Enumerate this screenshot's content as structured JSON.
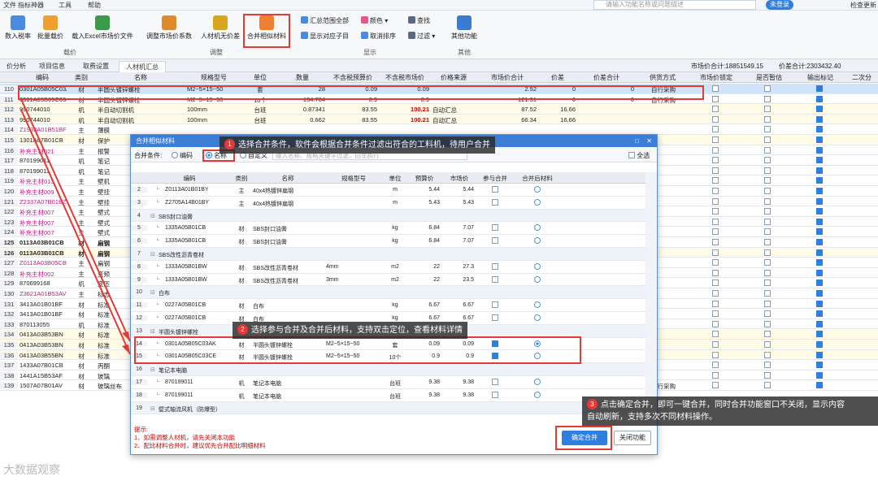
{
  "menu": [
    "文件",
    "指标神器",
    "工具",
    "帮助"
  ],
  "search_placeholder": "请输入功能名称或问题描述",
  "login": "未登录",
  "check_update": "检查更新",
  "ribbon": {
    "btn_tax": "数入税率",
    "btn_batch": "批量载价",
    "btn_excel": "载入Excel市场价文件",
    "group1": "载价",
    "btn_adjust": "调整市场价系数",
    "btn_nomaterial": "人材机无价差",
    "btn_merge": "合并相似材料",
    "group2": "调整",
    "btn_summary": "汇总范围全部",
    "btn_showsub": "显示对应子目",
    "btn_color": "颜色",
    "btn_cancelsort": "取消排序",
    "btn_find": "查找",
    "btn_filter": "过滤",
    "group3": "显示",
    "btn_other": "其他功能",
    "group4": "其他"
  },
  "tabs": [
    "价分析",
    "项目信息",
    "取费设置",
    "人材机汇总"
  ],
  "totals": {
    "market": "市场价合计:18851549.15",
    "diff": "价差合计:2303432.40"
  },
  "grid_headers": [
    "编码",
    "类别",
    "名称",
    "规格型号",
    "单位",
    "数量",
    "不含税预算价",
    "不含税市场价",
    "价格来源",
    "市场价合计",
    "价差",
    "价差合计",
    "供货方式",
    "市场价锁定",
    "是否暂估",
    "输出标记",
    "二次分"
  ],
  "grid_rows": [
    {
      "n": "110",
      "code": "0301A05B05C03AK",
      "cat": "材",
      "name": "半圆头镀锌螺栓",
      "spec": "M2~5×15~50",
      "unit": "套",
      "qty": "28",
      "pb": "0.09",
      "pm": "0.09",
      "src": "",
      "tm": "2.52",
      "d": "0",
      "td": "0",
      "sup": "自行采购",
      "lock": false,
      "est": false,
      "out": true,
      "cls": "rowsel"
    },
    {
      "n": "111",
      "code": "0301A05B05C03CE",
      "cat": "材",
      "name": "半圆头镀锌螺栓",
      "spec": "M2~5×15~50",
      "unit": "10个",
      "qty": "134.784",
      "pb": "0.9",
      "pm": "0.9",
      "src": "",
      "tm": "121.31",
      "d": "0",
      "td": "0",
      "sup": "自行采购",
      "lock": false,
      "est": false,
      "out": true,
      "cls": ""
    },
    {
      "n": "112",
      "code": "990744010",
      "cat": "机",
      "name": "半自动切割机",
      "spec": "100mm",
      "unit": "台班",
      "qty": "0.87341",
      "pb": "83.55",
      "pm": "100.21",
      "src": "自动汇总",
      "tm": "87.52",
      "d": "16.66",
      "td": "",
      "sup": "",
      "lock": false,
      "est": false,
      "out": true,
      "cls": "rowy"
    },
    {
      "n": "113",
      "code": "990744010",
      "cat": "机",
      "name": "半自动切割机",
      "spec": "100mm",
      "unit": "台班",
      "qty": "0.662",
      "pb": "83.55",
      "pm": "100.21",
      "src": "自动汇总",
      "tm": "66.34",
      "d": "16.66",
      "td": "",
      "sup": "",
      "lock": false,
      "est": false,
      "out": true,
      "cls": "rowy"
    },
    {
      "n": "114",
      "code": "Z1933A01B51BF",
      "cat": "主",
      "name": "薄膜",
      "spec": "",
      "unit": "",
      "qty": "",
      "pb": "",
      "pm": "",
      "src": "",
      "tm": "",
      "d": "",
      "td": "",
      "sup": "",
      "lock": false,
      "est": false,
      "out": true,
      "cls": ""
    },
    {
      "n": "115",
      "code": "1301A07B01CB",
      "cat": "材",
      "name": "保护",
      "spec": "",
      "unit": "",
      "qty": "",
      "pb": "",
      "pm": "",
      "src": "",
      "tm": "",
      "d": "",
      "td": "",
      "sup": "",
      "lock": false,
      "est": false,
      "out": true,
      "cls": "rowy"
    },
    {
      "n": "116",
      "code": "补充主材021",
      "cat": "主",
      "name": "报警",
      "spec": "",
      "unit": "",
      "qty": "",
      "pb": "",
      "pm": "",
      "src": "",
      "tm": "",
      "d": "",
      "td": "",
      "sup": "",
      "lock": false,
      "est": false,
      "out": true,
      "cls": ""
    },
    {
      "n": "117",
      "code": "870199011",
      "cat": "机",
      "name": "笔记",
      "spec": "",
      "unit": "",
      "qty": "",
      "pb": "",
      "pm": "",
      "src": "",
      "tm": "",
      "d": "",
      "td": "",
      "sup": "",
      "lock": false,
      "est": false,
      "out": true,
      "cls": ""
    },
    {
      "n": "118",
      "code": "870199011",
      "cat": "机",
      "name": "笔记",
      "spec": "",
      "unit": "",
      "qty": "",
      "pb": "",
      "pm": "",
      "src": "",
      "tm": "",
      "d": "",
      "td": "",
      "sup": "",
      "lock": false,
      "est": false,
      "out": true,
      "cls": ""
    },
    {
      "n": "119",
      "code": "补充主材013",
      "cat": "主",
      "name": "壁机",
      "spec": "",
      "unit": "",
      "qty": "",
      "pb": "",
      "pm": "",
      "src": "",
      "tm": "",
      "d": "",
      "td": "",
      "sup": "",
      "lock": false,
      "est": false,
      "out": true,
      "cls": ""
    },
    {
      "n": "120",
      "code": "补充主材009",
      "cat": "主",
      "name": "壁挂",
      "spec": "",
      "unit": "",
      "qty": "",
      "pb": "",
      "pm": "",
      "src": "",
      "tm": "",
      "d": "",
      "td": "",
      "sup": "",
      "lock": false,
      "est": false,
      "out": true,
      "cls": ""
    },
    {
      "n": "121",
      "code": "Z2337A07B01BZ",
      "cat": "主",
      "name": "壁挂",
      "spec": "",
      "unit": "",
      "qty": "",
      "pb": "",
      "pm": "",
      "src": "",
      "tm": "",
      "d": "",
      "td": "",
      "sup": "",
      "lock": false,
      "est": false,
      "out": true,
      "cls": ""
    },
    {
      "n": "122",
      "code": "补充主材007",
      "cat": "主",
      "name": "壁式",
      "spec": "",
      "unit": "",
      "qty": "",
      "pb": "",
      "pm": "",
      "src": "",
      "tm": "",
      "d": "",
      "td": "",
      "sup": "",
      "lock": false,
      "est": false,
      "out": true,
      "cls": ""
    },
    {
      "n": "123",
      "code": "补充主材007",
      "cat": "主",
      "name": "壁式",
      "spec": "",
      "unit": "",
      "qty": "",
      "pb": "",
      "pm": "",
      "src": "",
      "tm": "",
      "d": "",
      "td": "",
      "sup": "",
      "lock": false,
      "est": false,
      "out": true,
      "cls": ""
    },
    {
      "n": "124",
      "code": "补充主材007",
      "cat": "主",
      "name": "壁式",
      "spec": "",
      "unit": "",
      "qty": "",
      "pb": "",
      "pm": "",
      "src": "",
      "tm": "",
      "d": "",
      "td": "",
      "sup": "",
      "lock": false,
      "est": false,
      "out": true,
      "cls": ""
    },
    {
      "n": "125",
      "code": "0113A03B01CB",
      "cat": "材",
      "name": "扁钢",
      "spec": "",
      "unit": "",
      "qty": "",
      "pb": "",
      "pm": "",
      "src": "",
      "tm": "",
      "d": "",
      "td": "",
      "sup": "",
      "lock": false,
      "est": false,
      "out": true,
      "cls": "bold"
    },
    {
      "n": "126",
      "code": "0113A03B01CB",
      "cat": "材",
      "name": "扁钢",
      "spec": "",
      "unit": "",
      "qty": "",
      "pb": "",
      "pm": "",
      "src": "",
      "tm": "",
      "d": "",
      "td": "",
      "sup": "",
      "lock": false,
      "est": false,
      "out": true,
      "cls": "bold rowy"
    },
    {
      "n": "127",
      "code": "Z0113A03B05CB",
      "cat": "主",
      "name": "扁钢",
      "spec": "",
      "unit": "",
      "qty": "",
      "pb": "",
      "pm": "",
      "src": "",
      "tm": "",
      "d": "",
      "td": "",
      "sup": "",
      "lock": false,
      "est": false,
      "out": true,
      "cls": ""
    },
    {
      "n": "128",
      "code": "补充主材002",
      "cat": "主",
      "name": "变频",
      "spec": "",
      "unit": "",
      "qty": "",
      "pb": "",
      "pm": "",
      "src": "",
      "tm": "",
      "d": "",
      "td": "",
      "sup": "",
      "lock": false,
      "est": false,
      "out": true,
      "cls": ""
    },
    {
      "n": "129",
      "code": "870699168",
      "cat": "机",
      "name": "变压",
      "spec": "",
      "unit": "",
      "qty": "",
      "pb": "",
      "pm": "",
      "src": "",
      "tm": "",
      "d": "",
      "td": "",
      "sup": "",
      "lock": false,
      "est": false,
      "out": true,
      "cls": ""
    },
    {
      "n": "130",
      "code": "Z3621A01B53AV",
      "cat": "主",
      "name": "标志",
      "spec": "",
      "unit": "",
      "qty": "",
      "pb": "",
      "pm": "",
      "src": "",
      "tm": "",
      "d": "",
      "td": "",
      "sup": "",
      "lock": false,
      "est": false,
      "out": true,
      "cls": ""
    },
    {
      "n": "131",
      "code": "3413A01B01BF",
      "cat": "材",
      "name": "标准",
      "spec": "",
      "unit": "",
      "qty": "",
      "pb": "",
      "pm": "",
      "src": "",
      "tm": "",
      "d": "",
      "td": "",
      "sup": "",
      "lock": false,
      "est": false,
      "out": true,
      "cls": ""
    },
    {
      "n": "132",
      "code": "3413A01B01BF",
      "cat": "材",
      "name": "标准",
      "spec": "",
      "unit": "",
      "qty": "",
      "pb": "",
      "pm": "",
      "src": "",
      "tm": "",
      "d": "",
      "td": "",
      "sup": "",
      "lock": false,
      "est": false,
      "out": true,
      "cls": ""
    },
    {
      "n": "133",
      "code": "870113055",
      "cat": "机",
      "name": "标准",
      "spec": "",
      "unit": "",
      "qty": "",
      "pb": "",
      "pm": "",
      "src": "",
      "tm": "",
      "d": "",
      "td": "",
      "sup": "",
      "lock": false,
      "est": false,
      "out": true,
      "cls": ""
    },
    {
      "n": "134",
      "code": "0413A03B53BN",
      "cat": "材",
      "name": "标准",
      "spec": "",
      "unit": "",
      "qty": "",
      "pb": "",
      "pm": "",
      "src": "",
      "tm": "",
      "d": "",
      "td": "",
      "sup": "",
      "lock": false,
      "est": false,
      "out": true,
      "cls": "rowy"
    },
    {
      "n": "135",
      "code": "0413A03B53BN",
      "cat": "材",
      "name": "标准",
      "spec": "",
      "unit": "",
      "qty": "",
      "pb": "",
      "pm": "",
      "src": "",
      "tm": "",
      "d": "",
      "td": "",
      "sup": "",
      "lock": false,
      "est": false,
      "out": true,
      "cls": "rowy"
    },
    {
      "n": "136",
      "code": "0413A03B55BN",
      "cat": "材",
      "name": "标准",
      "spec": "",
      "unit": "",
      "qty": "",
      "pb": "",
      "pm": "",
      "src": "",
      "tm": "",
      "d": "",
      "td": "",
      "sup": "",
      "lock": false,
      "est": false,
      "out": true,
      "cls": "rowy"
    },
    {
      "n": "137",
      "code": "1433A07B01CB",
      "cat": "材",
      "name": "丙酮",
      "spec": "",
      "unit": "",
      "qty": "",
      "pb": "",
      "pm": "",
      "src": "",
      "tm": "",
      "d": "",
      "td": "",
      "sup": "",
      "lock": false,
      "est": false,
      "out": true,
      "cls": ""
    },
    {
      "n": "138",
      "code": "1441A15B53AF",
      "cat": "材",
      "name": "玻璃",
      "spec": "",
      "unit": "",
      "qty": "",
      "pb": "",
      "pm": "",
      "src": "",
      "tm": "",
      "d": "",
      "td": "",
      "sup": "",
      "lock": false,
      "est": false,
      "out": true,
      "cls": ""
    },
    {
      "n": "139",
      "code": "1507A07B01AV",
      "cat": "材",
      "name": "玻璃丝布",
      "spec": "",
      "unit": "m2",
      "qty": "245.448",
      "pb": "2.48",
      "pm": "2.48",
      "src": "",
      "tm": "608.71",
      "d": "0",
      "td": "0",
      "sup": "自行采购",
      "lock": false,
      "est": false,
      "out": true,
      "cls": ""
    }
  ],
  "dialog": {
    "title": "合并相似材料",
    "cond_label": "合并条件:",
    "opt_code": "编码",
    "opt_name": "名称",
    "opt_custom": "自定义",
    "custom_placeholder": "输入名称、规格关键字过滤，回车执行",
    "all_label": "全选",
    "headers": [
      "编码",
      "类别",
      "名称",
      "规格型号",
      "单位",
      "预算价",
      "市场价",
      "参与合并",
      "合并后材料"
    ],
    "rows": [
      {
        "n": "2",
        "code": "Z0113A01B01BY",
        "cat": "主",
        "name": "40x4热镀锌扁钢",
        "spec": "",
        "unit": "m",
        "pb": "5.44",
        "pm": "5.44",
        "join": false,
        "after": false,
        "g": false
      },
      {
        "n": "3",
        "code": "Z2705A14B01BY",
        "cat": "主",
        "name": "40x4热镀锌扁钢",
        "spec": "",
        "unit": "m",
        "pb": "5.43",
        "pm": "5.43",
        "join": false,
        "after": false,
        "g": false
      },
      {
        "n": "4",
        "code": "SBS封口油膏",
        "cat": "",
        "name": "",
        "spec": "",
        "unit": "",
        "pb": "",
        "pm": "",
        "join": null,
        "after": null,
        "g": true
      },
      {
        "n": "5",
        "code": "1335A05B01CB",
        "cat": "材",
        "name": "SBS封口油膏",
        "spec": "",
        "unit": "kg",
        "pb": "6.84",
        "pm": "7.07",
        "join": false,
        "after": false,
        "g": false
      },
      {
        "n": "6",
        "code": "1335A05B01CB",
        "cat": "材",
        "name": "SBS封口油膏",
        "spec": "",
        "unit": "kg",
        "pb": "6.84",
        "pm": "7.07",
        "join": false,
        "after": false,
        "g": false
      },
      {
        "n": "7",
        "code": "SBS改性沥青卷材",
        "cat": "",
        "name": "",
        "spec": "",
        "unit": "",
        "pb": "",
        "pm": "",
        "join": null,
        "after": null,
        "g": true
      },
      {
        "n": "8",
        "code": "1333A05B01BW",
        "cat": "材",
        "name": "SBS改性沥青卷材",
        "spec": "4mm",
        "unit": "m2",
        "pb": "22",
        "pm": "27.3",
        "join": false,
        "after": false,
        "g": false
      },
      {
        "n": "9",
        "code": "1333A05B01BW",
        "cat": "材",
        "name": "SBS改性沥青卷材",
        "spec": "3mm",
        "unit": "m2",
        "pb": "22",
        "pm": "23.5",
        "join": false,
        "after": false,
        "g": false
      },
      {
        "n": "10",
        "code": "白布",
        "cat": "",
        "name": "",
        "spec": "",
        "unit": "",
        "pb": "",
        "pm": "",
        "join": null,
        "after": null,
        "g": true
      },
      {
        "n": "11",
        "code": "0227A05B01CB",
        "cat": "材",
        "name": "白布",
        "spec": "",
        "unit": "kg",
        "pb": "6.67",
        "pm": "6.67",
        "join": false,
        "after": false,
        "g": false
      },
      {
        "n": "12",
        "code": "0227A05B01CB",
        "cat": "材",
        "name": "白布",
        "spec": "",
        "unit": "kg",
        "pb": "6.67",
        "pm": "6.67",
        "join": false,
        "after": false,
        "g": false
      },
      {
        "n": "13",
        "code": "半圆头镀锌螺栓",
        "cat": "",
        "name": "",
        "spec": "",
        "unit": "",
        "pb": "",
        "pm": "",
        "join": null,
        "after": null,
        "g": true
      },
      {
        "n": "14",
        "code": "0301A05B05C03AK",
        "cat": "材",
        "name": "半圆头镀锌螺栓",
        "spec": "M2~5×15~50",
        "unit": "套",
        "pb": "0.09",
        "pm": "0.09",
        "join": true,
        "after": true,
        "g": false
      },
      {
        "n": "15",
        "code": "0301A05B05C03CE",
        "cat": "材",
        "name": "半圆头镀锌螺栓",
        "spec": "M2~5×15~50",
        "unit": "10个",
        "pb": "0.9",
        "pm": "0.9",
        "join": true,
        "after": false,
        "g": false
      },
      {
        "n": "16",
        "code": "笔记本电脑",
        "cat": "",
        "name": "",
        "spec": "",
        "unit": "",
        "pb": "",
        "pm": "",
        "join": null,
        "after": null,
        "g": true
      },
      {
        "n": "17",
        "code": "870199011",
        "cat": "机",
        "name": "笔记本电脑",
        "spec": "",
        "unit": "台班",
        "pb": "9.38",
        "pm": "9.38",
        "join": false,
        "after": false,
        "g": false
      },
      {
        "n": "18",
        "code": "870199011",
        "cat": "机",
        "name": "笔记本电脑",
        "spec": "",
        "unit": "台班",
        "pb": "9.38",
        "pm": "9.38",
        "join": false,
        "after": false,
        "g": false
      },
      {
        "n": "19",
        "code": "壁式轴流风机（防爆型）",
        "cat": "",
        "name": "",
        "spec": "",
        "unit": "",
        "pb": "",
        "pm": "",
        "join": null,
        "after": null,
        "g": true
      }
    ],
    "notes_title": "提示:",
    "note1": "1、如需调整人材机，请先关闭本功能",
    "note2": "2、配比材料合并时，建议优先合并配比明细材料",
    "btn_ok": "确定合并",
    "btn_close": "关闭功能"
  },
  "callouts": {
    "c1_num": "1",
    "c1": "选择合并条件，软件会根据合并条件过滤出符合的工料机，待用户合并",
    "c2_num": "2",
    "c2": "选择参与合并及合并后材料，支持双击定位，查看材料详情",
    "c3_num": "3",
    "c3a": "点击确定合并，即可一键合并，同时合并功能窗口不关闭，显示内容",
    "c3b": "自动刷新，支持多次不同材料操作。"
  },
  "watermark": "大数据观察",
  "colors": {
    "accent": "#2f7fe0",
    "highlight": "#e53935",
    "price_red": "#c00000"
  }
}
